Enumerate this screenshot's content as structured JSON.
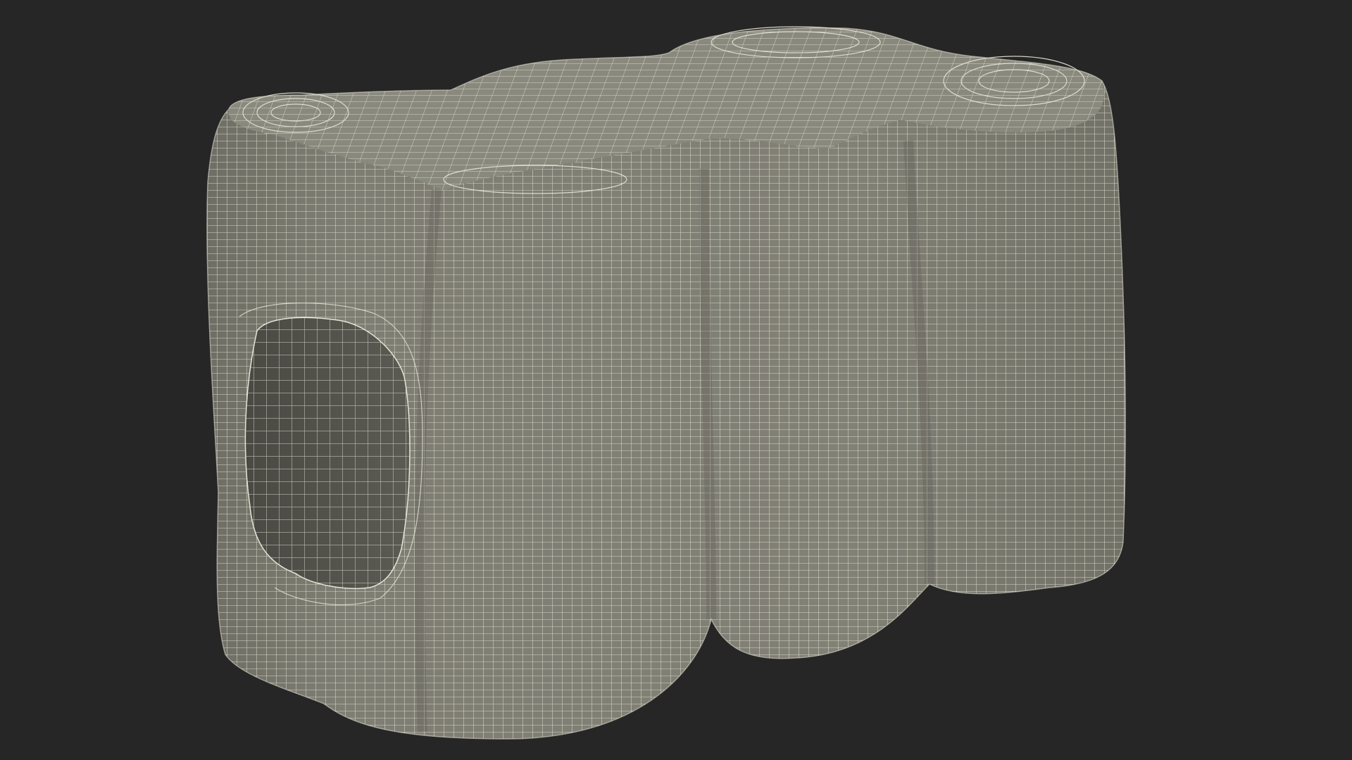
{
  "scene": {
    "background_color": "#262626",
    "mesh": {
      "kind": "wireframe-3d-model",
      "subject": "six-pack-can-shrink-wrap",
      "shading_color": "#7d7c72",
      "shadow_color": "#5e5d56",
      "top_color": "#8a897e",
      "wire_color": "#e7e5d6"
    }
  }
}
